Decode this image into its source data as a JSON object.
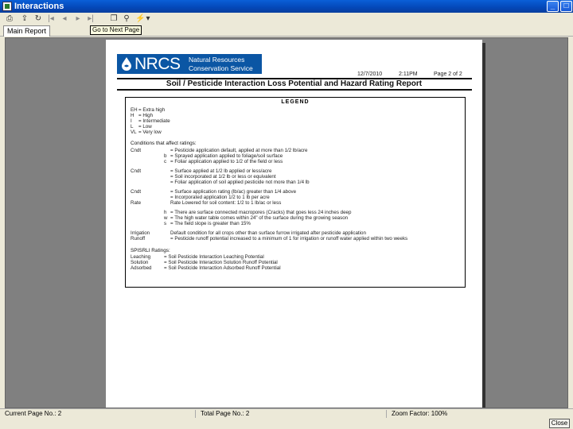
{
  "window": {
    "title": "Interactions",
    "minimize_label": "_",
    "maximize_label": "□"
  },
  "toolbar": {
    "icons": [
      {
        "name": "print-icon",
        "glyph": "⎙"
      },
      {
        "name": "export-icon",
        "glyph": "⇪"
      },
      {
        "name": "refresh-icon",
        "glyph": "↻"
      },
      {
        "name": "first-page-icon",
        "glyph": "|◂"
      },
      {
        "name": "previous-page-icon",
        "glyph": "◂"
      },
      {
        "name": "next-page-icon",
        "glyph": "▸"
      },
      {
        "name": "last-page-icon",
        "glyph": "▸|"
      },
      {
        "name": "copy-icon",
        "glyph": "❐"
      },
      {
        "name": "search-icon",
        "glyph": "⚲"
      },
      {
        "name": "zoom-icon",
        "glyph": "⚡"
      },
      {
        "name": "dropdown-icon",
        "glyph": "▾"
      }
    ]
  },
  "tab": {
    "label": "Main Report"
  },
  "tooltip": {
    "text": "Go to Next Page"
  },
  "report": {
    "logo_abbr": "NRCS",
    "logo_full": "Natural Resources\nConservation Service",
    "date": "12/7/2010",
    "time": "2:11PM",
    "page_label": "Page 2 of 2",
    "title": "Soil / Pesticide Interaction Loss Potential and Hazard Rating Report",
    "legend_title": "LEGEND",
    "legend_rows": [
      {
        "k": "EH",
        "v": "= Extra high"
      },
      {
        "k": "H",
        "v": "= High"
      },
      {
        "k": "I",
        "v": "= Intermediate"
      },
      {
        "k": "L",
        "v": "= Low"
      },
      {
        "k": "VL",
        "v": "= Very low"
      }
    ],
    "conditions_title": "Conditions that affect ratings:",
    "conditions": [
      {
        "k": "Cndt",
        "i": "",
        "v": "= Pesticide application default, applied at more than 1/2 lb/acre"
      },
      {
        "k": "",
        "i": "b",
        "v": "= Sprayed application applied to foliage/soil surface"
      },
      {
        "k": "",
        "i": "c",
        "v": "= Foliar application applied to 1/2 of the field or less"
      },
      {
        "k": "Cndt",
        "i": "",
        "v": "= Surface applied at 1/2 lb applied or less/acre"
      },
      {
        "k": "",
        "i": "",
        "v": "= Soil incorporated at 1/2 lb or less or equivalent"
      },
      {
        "k": "",
        "i": "",
        "v": "= Foliar application of soil applied pesticide not more than 1/4 lb"
      },
      {
        "k": "Cndt",
        "i": "",
        "v": "= Surface application rating (lb/ac) greater than 1/4 above"
      },
      {
        "k": "",
        "i": "",
        "v": "= Incorporated application 1/2 to 1 lb per acre"
      },
      {
        "k": "Rate",
        "i": "",
        "v": "Rate Lowered for soil content: 1/2 to 1 lb/ac or less"
      },
      {
        "k": "",
        "i": "h",
        "v": "= There are surface connected macropores (Cracks) that goes less 24 inches deep"
      },
      {
        "k": "",
        "i": "w",
        "v": "= The high water table comes within 24\" of the surface during the growing season"
      },
      {
        "k": "",
        "i": "s",
        "v": "= The field slope is greater than 15%"
      },
      {
        "k": "Irrigation",
        "i": "",
        "v": "Default condition for all crops other than surface furrow irrigated after pesticide application"
      },
      {
        "k": "Runoff",
        "i": "",
        "v": "= Pesticide runoff potential increased to a minimum of 1 for irrigation or runoff water applied within two weeks"
      }
    ],
    "ratings_title": "SPISRLI Ratings:",
    "ratings": [
      {
        "k": "Leaching",
        "v": "= Soil Pesticide Interaction Leaching Potential"
      },
      {
        "k": "Solution",
        "v": "= Soil Pesticide Interaction Solution Runoff Potential"
      },
      {
        "k": "Adsorbed",
        "v": "= Soil Pesticide Interaction Adsorbed Runoff Potential"
      }
    ]
  },
  "status": {
    "current_page": "Current Page No.: 2",
    "total_pages": "Total Page No.: 2",
    "zoom": "Zoom Factor: 100%"
  },
  "close_label": "Close"
}
